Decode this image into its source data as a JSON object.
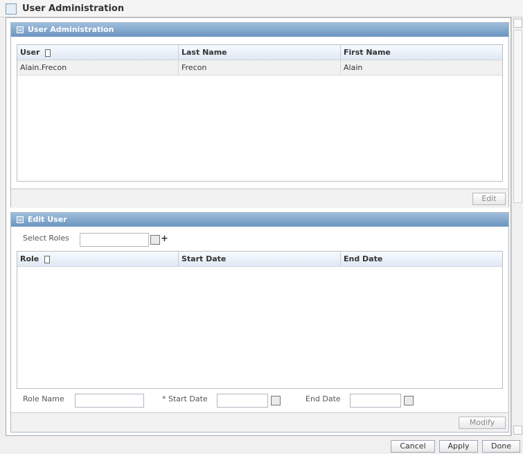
{
  "window": {
    "title": "User Administration"
  },
  "user_admin_panel": {
    "title": "User Administration",
    "table": {
      "columns": [
        "User",
        "Last Name",
        "First Name"
      ],
      "rows": [
        [
          "Alain.Frecon",
          "Frecon",
          "Alain"
        ]
      ]
    },
    "edit_label": "Edit"
  },
  "edit_user_panel": {
    "title": "Edit User",
    "select_roles_label": "Select Roles",
    "select_roles_value": "",
    "table": {
      "columns": [
        "Role",
        "Start Date",
        "End Date"
      ],
      "rows": []
    },
    "role_name_label": "Role Name",
    "start_date_label": "* Start Date",
    "end_date_label": "End Date",
    "role_name_value": "",
    "start_date_value": "",
    "end_date_value": "",
    "modify_label": "Modify"
  },
  "footer": {
    "cancel_label": "Cancel",
    "apply_label": "Apply",
    "done_label": "Done"
  },
  "colors": {
    "panel_header": "#7ea3c9",
    "grid_header": "#e6edf5"
  },
  "icons": {
    "collapse": "minus-box-icon",
    "sort": "sort-icon",
    "calendar": "calendar-icon",
    "add": "plus-icon"
  }
}
